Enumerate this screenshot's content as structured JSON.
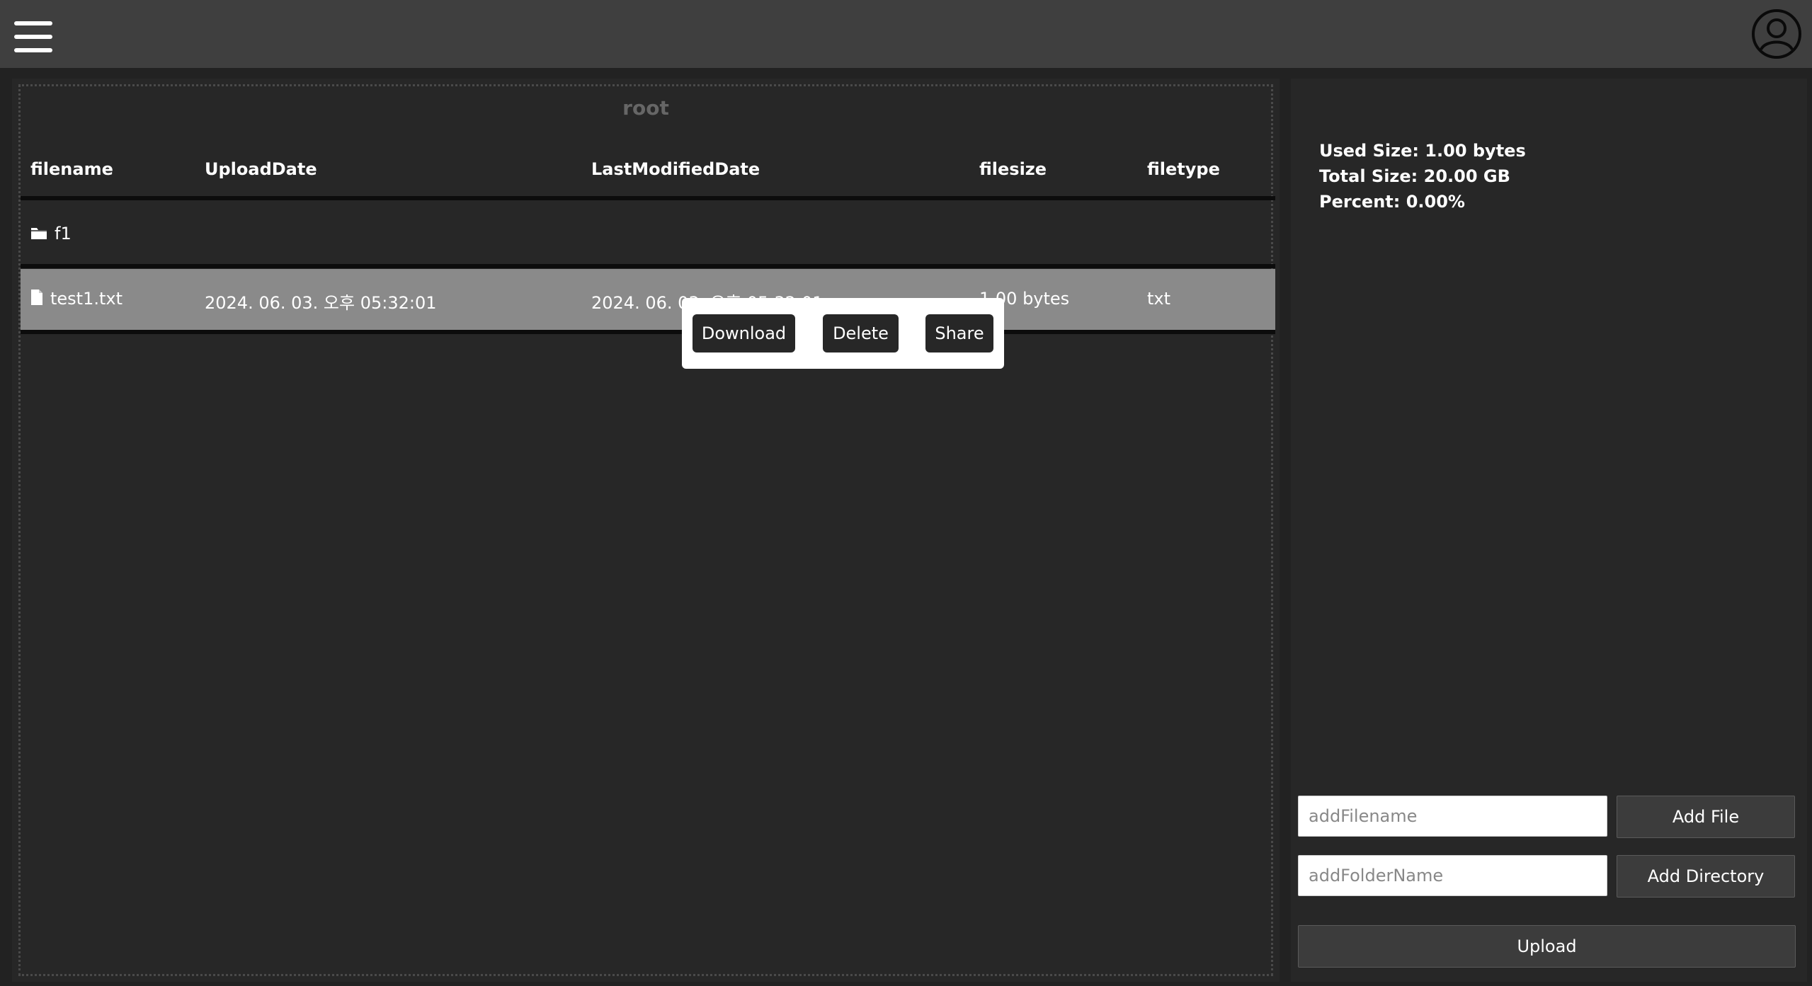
{
  "topbar": {
    "menu_icon": "hamburger-menu-icon",
    "avatar_icon": "user-avatar-icon"
  },
  "file_panel": {
    "title": "root",
    "columns": [
      "filename",
      "UploadDate",
      "LastModifiedDate",
      "filesize",
      "filetype"
    ],
    "rows": [
      {
        "icon": "folder-icon",
        "filename": "f1",
        "upload_date": "",
        "modified_date": "",
        "filesize": "",
        "filetype": ""
      },
      {
        "icon": "file-icon",
        "filename": "test1.txt",
        "upload_date": "2024. 06. 03. 오후 05:32:01",
        "modified_date": "2024. 06. 03. 오후 05:32:01",
        "filesize": "1.00 bytes",
        "filetype": "txt"
      }
    ]
  },
  "context_menu": {
    "download_label": "Download",
    "delete_label": "Delete",
    "share_label": "Share"
  },
  "side_panel": {
    "used_size": "Used Size: 1.00 bytes",
    "total_size": "Total Size: 20.00 GB",
    "percent": "Percent: 0.00%",
    "add_filename_placeholder": "addFilename",
    "add_folder_placeholder": "addFolderName",
    "add_file_label": "Add File",
    "add_directory_label": "Add Directory",
    "upload_label": "Upload"
  },
  "colors": {
    "background": "#222222",
    "topbar": "#3f3f3f",
    "panel": "#272727",
    "selected_row": "#8a8a8a",
    "popup": "#ffffff"
  }
}
